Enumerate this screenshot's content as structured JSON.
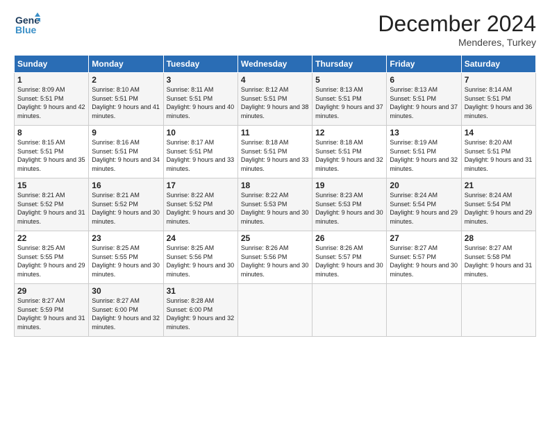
{
  "logo": {
    "part1": "General",
    "part2": "Blue"
  },
  "title": "December 2024",
  "subtitle": "Menderes, Turkey",
  "days_header": [
    "Sunday",
    "Monday",
    "Tuesday",
    "Wednesday",
    "Thursday",
    "Friday",
    "Saturday"
  ],
  "weeks": [
    [
      {
        "day": "1",
        "sunrise": "Sunrise: 8:09 AM",
        "sunset": "Sunset: 5:51 PM",
        "daylight": "Daylight: 9 hours and 42 minutes."
      },
      {
        "day": "2",
        "sunrise": "Sunrise: 8:10 AM",
        "sunset": "Sunset: 5:51 PM",
        "daylight": "Daylight: 9 hours and 41 minutes."
      },
      {
        "day": "3",
        "sunrise": "Sunrise: 8:11 AM",
        "sunset": "Sunset: 5:51 PM",
        "daylight": "Daylight: 9 hours and 40 minutes."
      },
      {
        "day": "4",
        "sunrise": "Sunrise: 8:12 AM",
        "sunset": "Sunset: 5:51 PM",
        "daylight": "Daylight: 9 hours and 38 minutes."
      },
      {
        "day": "5",
        "sunrise": "Sunrise: 8:13 AM",
        "sunset": "Sunset: 5:51 PM",
        "daylight": "Daylight: 9 hours and 37 minutes."
      },
      {
        "day": "6",
        "sunrise": "Sunrise: 8:13 AM",
        "sunset": "Sunset: 5:51 PM",
        "daylight": "Daylight: 9 hours and 37 minutes."
      },
      {
        "day": "7",
        "sunrise": "Sunrise: 8:14 AM",
        "sunset": "Sunset: 5:51 PM",
        "daylight": "Daylight: 9 hours and 36 minutes."
      }
    ],
    [
      {
        "day": "8",
        "sunrise": "Sunrise: 8:15 AM",
        "sunset": "Sunset: 5:51 PM",
        "daylight": "Daylight: 9 hours and 35 minutes."
      },
      {
        "day": "9",
        "sunrise": "Sunrise: 8:16 AM",
        "sunset": "Sunset: 5:51 PM",
        "daylight": "Daylight: 9 hours and 34 minutes."
      },
      {
        "day": "10",
        "sunrise": "Sunrise: 8:17 AM",
        "sunset": "Sunset: 5:51 PM",
        "daylight": "Daylight: 9 hours and 33 minutes."
      },
      {
        "day": "11",
        "sunrise": "Sunrise: 8:18 AM",
        "sunset": "Sunset: 5:51 PM",
        "daylight": "Daylight: 9 hours and 33 minutes."
      },
      {
        "day": "12",
        "sunrise": "Sunrise: 8:18 AM",
        "sunset": "Sunset: 5:51 PM",
        "daylight": "Daylight: 9 hours and 32 minutes."
      },
      {
        "day": "13",
        "sunrise": "Sunrise: 8:19 AM",
        "sunset": "Sunset: 5:51 PM",
        "daylight": "Daylight: 9 hours and 32 minutes."
      },
      {
        "day": "14",
        "sunrise": "Sunrise: 8:20 AM",
        "sunset": "Sunset: 5:51 PM",
        "daylight": "Daylight: 9 hours and 31 minutes."
      }
    ],
    [
      {
        "day": "15",
        "sunrise": "Sunrise: 8:21 AM",
        "sunset": "Sunset: 5:52 PM",
        "daylight": "Daylight: 9 hours and 31 minutes."
      },
      {
        "day": "16",
        "sunrise": "Sunrise: 8:21 AM",
        "sunset": "Sunset: 5:52 PM",
        "daylight": "Daylight: 9 hours and 30 minutes."
      },
      {
        "day": "17",
        "sunrise": "Sunrise: 8:22 AM",
        "sunset": "Sunset: 5:52 PM",
        "daylight": "Daylight: 9 hours and 30 minutes."
      },
      {
        "day": "18",
        "sunrise": "Sunrise: 8:22 AM",
        "sunset": "Sunset: 5:53 PM",
        "daylight": "Daylight: 9 hours and 30 minutes."
      },
      {
        "day": "19",
        "sunrise": "Sunrise: 8:23 AM",
        "sunset": "Sunset: 5:53 PM",
        "daylight": "Daylight: 9 hours and 30 minutes."
      },
      {
        "day": "20",
        "sunrise": "Sunrise: 8:24 AM",
        "sunset": "Sunset: 5:54 PM",
        "daylight": "Daylight: 9 hours and 29 minutes."
      },
      {
        "day": "21",
        "sunrise": "Sunrise: 8:24 AM",
        "sunset": "Sunset: 5:54 PM",
        "daylight": "Daylight: 9 hours and 29 minutes."
      }
    ],
    [
      {
        "day": "22",
        "sunrise": "Sunrise: 8:25 AM",
        "sunset": "Sunset: 5:55 PM",
        "daylight": "Daylight: 9 hours and 29 minutes."
      },
      {
        "day": "23",
        "sunrise": "Sunrise: 8:25 AM",
        "sunset": "Sunset: 5:55 PM",
        "daylight": "Daylight: 9 hours and 30 minutes."
      },
      {
        "day": "24",
        "sunrise": "Sunrise: 8:25 AM",
        "sunset": "Sunset: 5:56 PM",
        "daylight": "Daylight: 9 hours and 30 minutes."
      },
      {
        "day": "25",
        "sunrise": "Sunrise: 8:26 AM",
        "sunset": "Sunset: 5:56 PM",
        "daylight": "Daylight: 9 hours and 30 minutes."
      },
      {
        "day": "26",
        "sunrise": "Sunrise: 8:26 AM",
        "sunset": "Sunset: 5:57 PM",
        "daylight": "Daylight: 9 hours and 30 minutes."
      },
      {
        "day": "27",
        "sunrise": "Sunrise: 8:27 AM",
        "sunset": "Sunset: 5:57 PM",
        "daylight": "Daylight: 9 hours and 30 minutes."
      },
      {
        "day": "28",
        "sunrise": "Sunrise: 8:27 AM",
        "sunset": "Sunset: 5:58 PM",
        "daylight": "Daylight: 9 hours and 31 minutes."
      }
    ],
    [
      {
        "day": "29",
        "sunrise": "Sunrise: 8:27 AM",
        "sunset": "Sunset: 5:59 PM",
        "daylight": "Daylight: 9 hours and 31 minutes."
      },
      {
        "day": "30",
        "sunrise": "Sunrise: 8:27 AM",
        "sunset": "Sunset: 6:00 PM",
        "daylight": "Daylight: 9 hours and 32 minutes."
      },
      {
        "day": "31",
        "sunrise": "Sunrise: 8:28 AM",
        "sunset": "Sunset: 6:00 PM",
        "daylight": "Daylight: 9 hours and 32 minutes."
      },
      null,
      null,
      null,
      null
    ]
  ]
}
